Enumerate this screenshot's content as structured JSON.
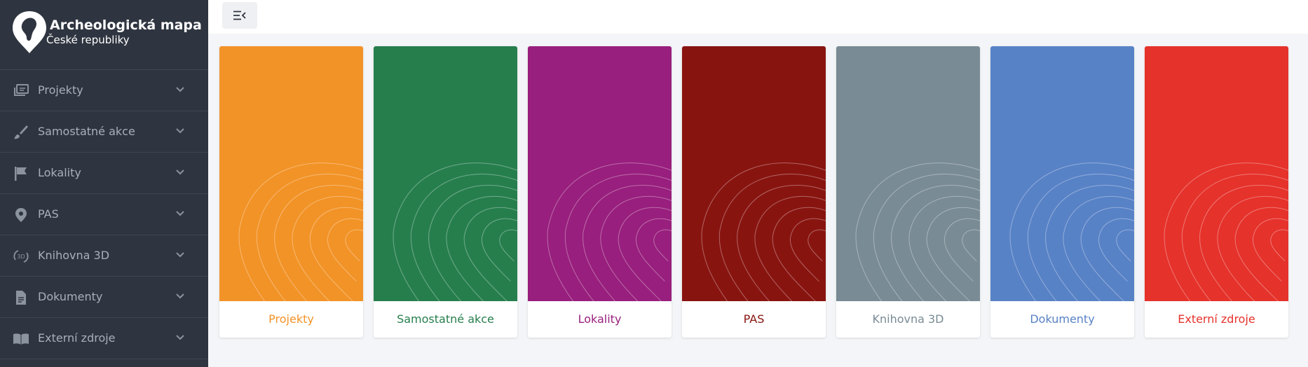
{
  "app": {
    "title": "Archeologická mapa",
    "subtitle": "České republiky"
  },
  "sidebar": {
    "items": [
      {
        "label": "Projekty",
        "icon": "projects-icon"
      },
      {
        "label": "Samostatné akce",
        "icon": "brush-icon"
      },
      {
        "label": "Lokality",
        "icon": "flag-icon"
      },
      {
        "label": "PAS",
        "icon": "map-pin-icon"
      },
      {
        "label": "Knihovna 3D",
        "icon": "rotate-3d-icon"
      },
      {
        "label": "Dokumenty",
        "icon": "document-icon"
      },
      {
        "label": "Externí zdroje",
        "icon": "book-icon"
      }
    ]
  },
  "topbar": {
    "toggle_icon": "sidebar-toggle-icon"
  },
  "cards": [
    {
      "label": "Projekty",
      "color": "#f29327",
      "text_color": "#f29327"
    },
    {
      "label": "Samostatné akce",
      "color": "#267e4d",
      "text_color": "#267e4d"
    },
    {
      "label": "Lokality",
      "color": "#981f7d",
      "text_color": "#981f7d"
    },
    {
      "label": "PAS",
      "color": "#881410",
      "text_color": "#881410"
    },
    {
      "label": "Knihovna 3D",
      "color": "#798b95",
      "text_color": "#798b95"
    },
    {
      "label": "Dokumenty",
      "color": "#5882c6",
      "text_color": "#5882c6"
    },
    {
      "label": "Externí zdroje",
      "color": "#e5322b",
      "text_color": "#e5322b"
    }
  ]
}
